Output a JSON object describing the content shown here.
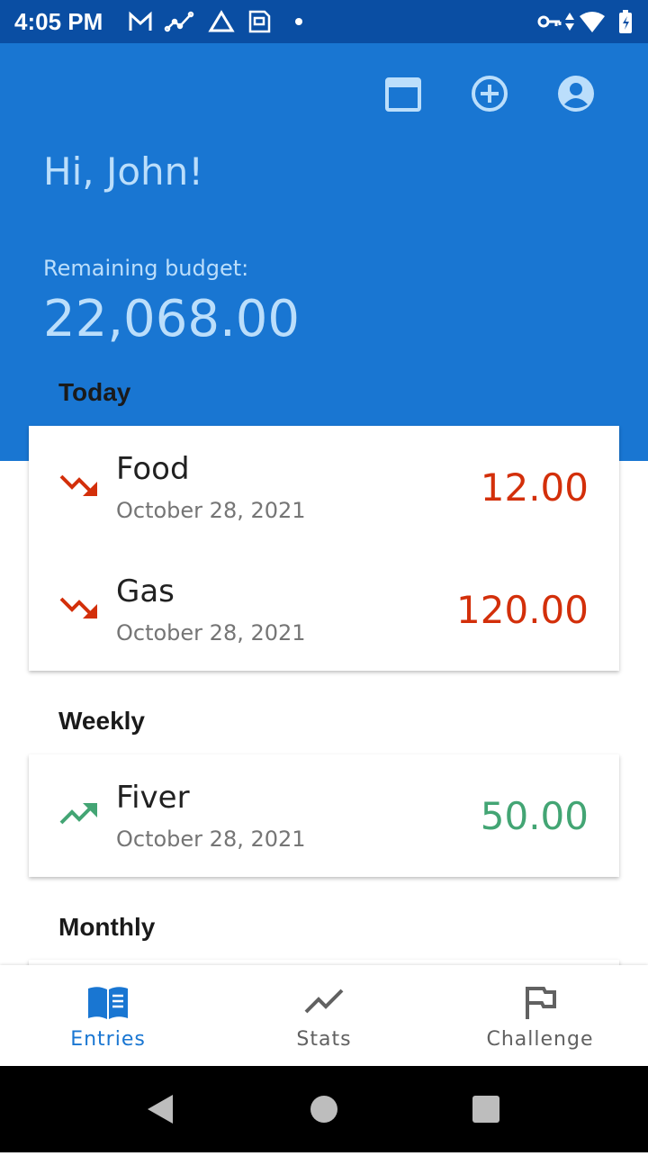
{
  "status_bar": {
    "time": "4:05 PM",
    "icons_left": [
      "gmail-icon",
      "analytics-icon",
      "drive-icon",
      "sim-lock-icon",
      "dot-icon"
    ],
    "icons_right": [
      "vpn-key-icon",
      "data-arrows-icon",
      "wifi-icon",
      "battery-icon"
    ]
  },
  "header": {
    "greeting": "Hi, John!",
    "budget_label": "Remaining budget:",
    "budget_value": "22,068.00",
    "actions": [
      "calendar-icon",
      "add-circle-icon",
      "account-icon"
    ],
    "bg_color": "#1976d2"
  },
  "sections": [
    {
      "title": "Today",
      "entries": [
        {
          "name": "Food",
          "date": "October 28, 2021",
          "amount": "12.00",
          "direction": "down"
        },
        {
          "name": "Gas",
          "date": "October 28, 2021",
          "amount": "120.00",
          "direction": "down"
        }
      ]
    },
    {
      "title": "Weekly",
      "entries": [
        {
          "name": "Fiver",
          "date": "October 28, 2021",
          "amount": "50.00",
          "direction": "up"
        }
      ]
    },
    {
      "title": "Monthly",
      "entries": []
    }
  ],
  "colors": {
    "expense": "#d32f0a",
    "income": "#43a574",
    "accent": "#1976d2",
    "inactive": "#616161"
  },
  "bottom_nav": {
    "items": [
      {
        "label": "Entries",
        "icon": "book-icon",
        "active": true
      },
      {
        "label": "Stats",
        "icon": "trend-line-icon",
        "active": false
      },
      {
        "label": "Challenge",
        "icon": "flag-icon",
        "active": false
      }
    ]
  },
  "system_nav": [
    "back-icon",
    "home-icon",
    "recents-icon"
  ]
}
